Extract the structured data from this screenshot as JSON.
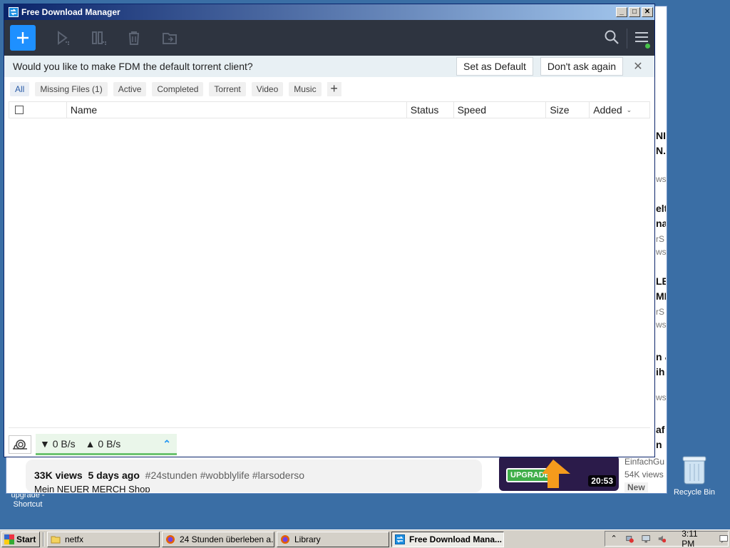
{
  "window": {
    "title": "Free Download Manager"
  },
  "notice": {
    "message": "Would you like to make FDM the default torrent client?",
    "set_default": "Set as Default",
    "dont_ask": "Don't ask again"
  },
  "filters": [
    "All",
    "Missing Files (1)",
    "Active",
    "Completed",
    "Torrent",
    "Video",
    "Music"
  ],
  "columns": {
    "name": "Name",
    "status": "Status",
    "speed": "Speed",
    "size": "Size",
    "added": "Added"
  },
  "status": {
    "download_speed": "0 B/s",
    "upload_speed": "0 B/s"
  },
  "background_page": {
    "views": "33K views",
    "age": "5 days ago",
    "hashtags": "#24stunden #wobblylife #larsoderso",
    "merch_line": "Mein NEUER MERCH Shop",
    "thumb_badge": "UPGRADE",
    "duration": "20:53",
    "channel": "EinfachGu",
    "channel_views": "54K views",
    "new_badge": "New",
    "side_fragments": [
      "NI",
      "N.",
      "ws",
      "elt",
      "nal",
      "rS",
      "ws",
      "LB",
      "MI",
      "rS",
      "ws",
      "n &",
      "ih",
      "ws",
      "af",
      "n"
    ]
  },
  "desktop": {
    "recycle_bin": "Recycle Bin",
    "shortcut_caption": "upgrade - Shortcut"
  },
  "taskbar": {
    "start": "Start",
    "tasks": [
      "netfx",
      "24 Stunden überleben a...",
      "Library",
      "Free Download Mana..."
    ],
    "clock": "3:11 PM"
  },
  "colors": {
    "accent": "#1e90ff",
    "toolbar": "#2e3440",
    "notice_bg": "#e8f0f4",
    "speed_bar": "#6cc36f"
  }
}
